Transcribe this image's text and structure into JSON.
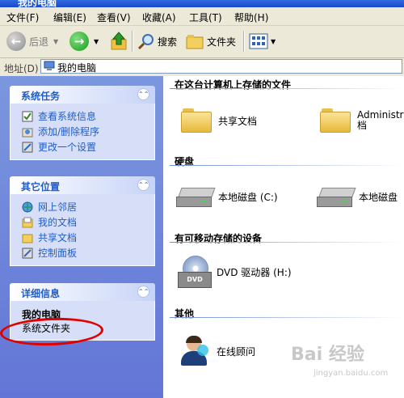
{
  "window": {
    "title": "我的电脑"
  },
  "menu": [
    "文件(F)",
    "编辑(E)",
    "查看(V)",
    "收藏(A)",
    "工具(T)",
    "帮助(H)"
  ],
  "toolbar": {
    "back_label": "后退",
    "search_label": "搜索",
    "folders_label": "文件夹"
  },
  "address": {
    "label": "地址(D)",
    "value": "我的电脑"
  },
  "left": {
    "system_tasks": {
      "title": "系统任务",
      "items": [
        "查看系统信息",
        "添加/删除程序",
        "更改一个设置"
      ]
    },
    "other_places": {
      "title": "其它位置",
      "items": [
        "网上邻居",
        "我的文档",
        "共享文档",
        "控制面板"
      ]
    },
    "details": {
      "title": "详细信息",
      "name": "我的电脑",
      "sub": "系统文件夹"
    }
  },
  "right": {
    "section_stored": "在这台计算机上存储的文件",
    "shared_docs": "共享文档",
    "admin_docs": "Administra\n档",
    "section_disks": "硬盘",
    "local_c": "本地磁盘 (C:)",
    "local_d": "本地磁盘",
    "section_removable": "有可移动存储的设备",
    "dvd": "DVD 驱动器 (H:)",
    "dvd_badge": "DVD",
    "section_other": "其他",
    "online": "在线顾问"
  },
  "watermark": {
    "main": "Bai 经验",
    "sub": "jingyan.baidu.com"
  },
  "colors": {
    "accent": "#215dc6",
    "left_pane": "#6f86da",
    "highlight": "#e00000"
  }
}
